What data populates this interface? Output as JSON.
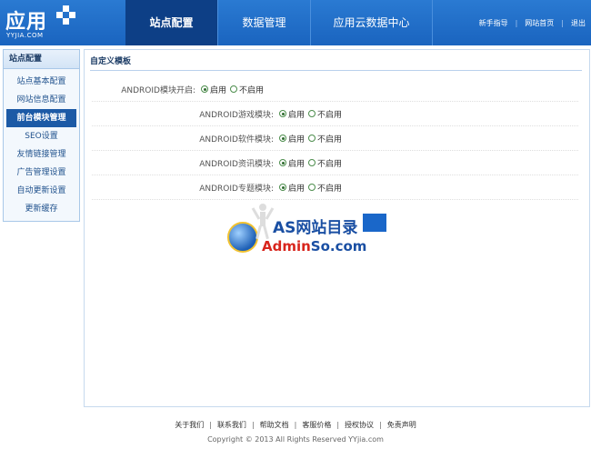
{
  "logo": {
    "main": "应用",
    "sub": "YYJIA.COM"
  },
  "nav": {
    "tabs": [
      "站点配置",
      "数据管理",
      "应用云数据中心"
    ]
  },
  "toplinks": [
    "新手指导",
    "网站首页",
    "退出"
  ],
  "toplinks_sep": "|",
  "sidebar": {
    "title": "站点配置",
    "items": [
      "站点基本配置",
      "网站信息配置",
      "前台模块管理",
      "SEO设置",
      "友情链接管理",
      "广告管理设置",
      "自动更新设置",
      "更新缓存"
    ]
  },
  "panel": {
    "title": "自定义模板",
    "rows": [
      {
        "label": "ANDROID模块开启:",
        "on": "启用",
        "off": "不启用"
      },
      {
        "label": "ANDROID游戏模块:",
        "on": "启用",
        "off": "不启用"
      },
      {
        "label": "ANDROID软件模块:",
        "on": "启用",
        "off": "不启用"
      },
      {
        "label": "ANDROID资讯模块:",
        "on": "启用",
        "off": "不启用"
      },
      {
        "label": "ANDROID专题模块:",
        "on": "启用",
        "off": "不启用"
      }
    ]
  },
  "watermark": {
    "line1": "AS网站目录",
    "line2_a": "Admin",
    "line2_b": "So.com"
  },
  "footer": {
    "links": [
      "关于我们",
      "联系我们",
      "帮助文档",
      "客服价格",
      "授权协议",
      "免责声明"
    ],
    "sep": "|",
    "copyright": "Copyright © 2013 All Rights Reserved YYjia.com"
  },
  "colors": {
    "header": "#1e6bc6",
    "nav_active": "#0d3f86",
    "sidebar_active": "#1c5aa6"
  }
}
